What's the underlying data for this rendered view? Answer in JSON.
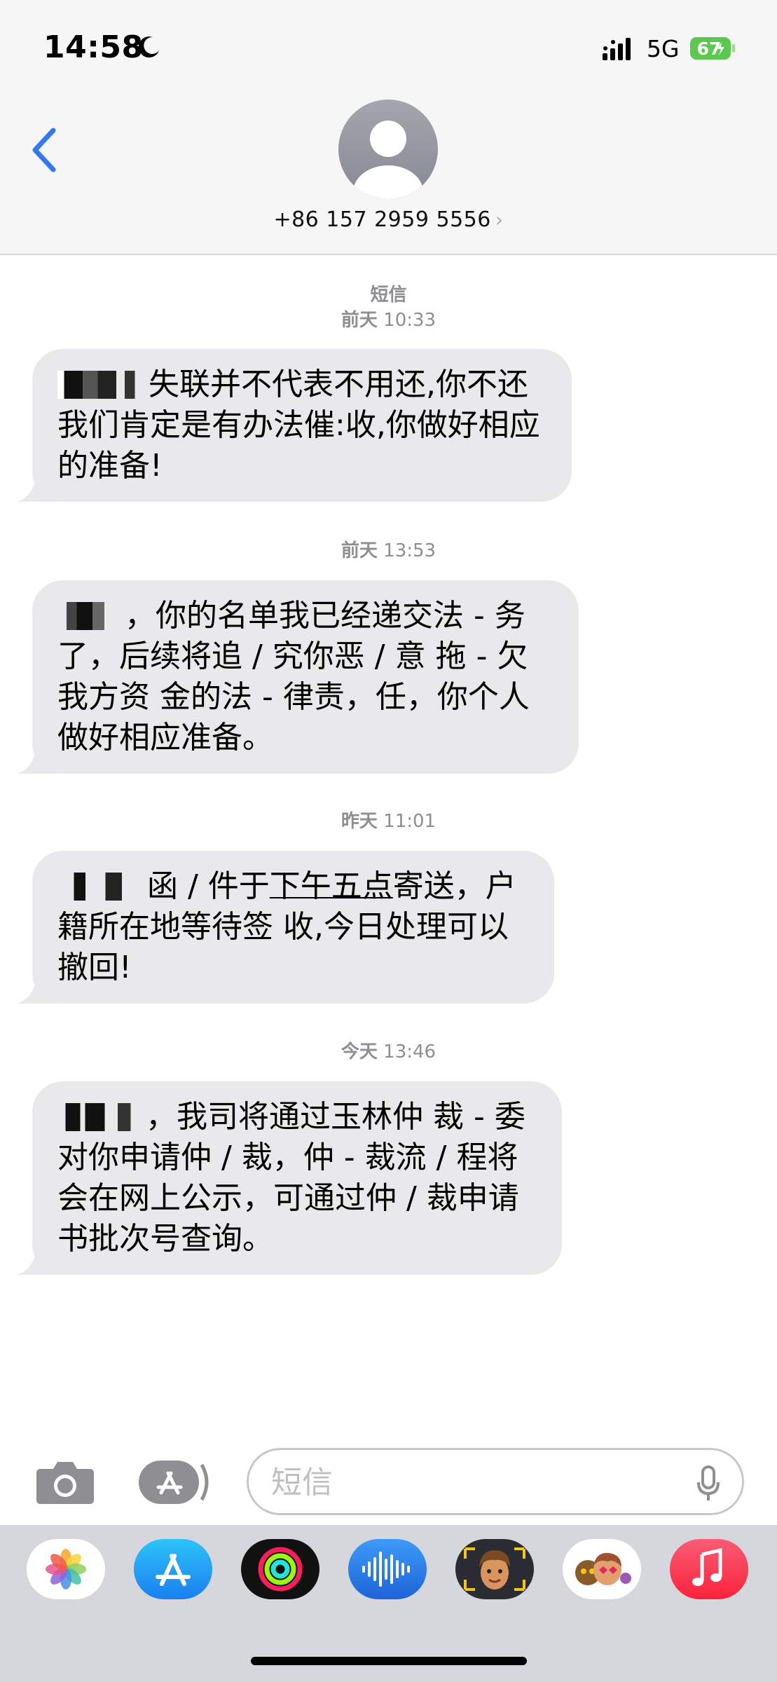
{
  "status_bar": {
    "time": "14:58",
    "network": "5G",
    "battery": "67"
  },
  "header": {
    "contact": "+86 157 2959 5556"
  },
  "conversation": {
    "service_label": "短信",
    "messages": [
      {
        "day": "前天",
        "time": "10:33",
        "text": "失联并不代表不用还,你不还我们肯定是有办法催:收,你做好相应的准备!"
      },
      {
        "day": "前天",
        "time": "13:53",
        "text": "，你的名单我已经递交法 - 务了，后续将追 / 究你恶 / 意 拖 - 欠我方资 金的法 - 律责，任，你个人做好相应准备。"
      },
      {
        "day": "昨天",
        "time": "11:01",
        "text_a": "函 / 件于",
        "text_u": "下午五点",
        "text_b": "寄送，户 籍所在地等待签 收,今日处理可以撤回!"
      },
      {
        "day": "今天",
        "time": "13:46",
        "text": "，我司将通过玉林仲 裁 - 委对你申请仲 / 裁，仲 - 裁流 / 程将会在网上公示，可通过仲 / 裁申请书批次号查询。"
      }
    ]
  },
  "compose": {
    "placeholder": "短信"
  },
  "icons": {
    "back": "chevron-left-icon",
    "camera": "camera-icon",
    "apps": "app-store-icon",
    "mic": "microphone-icon"
  },
  "app_drawer": [
    "Photos",
    "App Store",
    "Fitness",
    "Audio Messages",
    "Memoji Stickers",
    "Animoji",
    "Music"
  ],
  "colors": {
    "accent": "#3478f6",
    "bubble": "#e9e9eb",
    "battery": "#5ac84e"
  }
}
